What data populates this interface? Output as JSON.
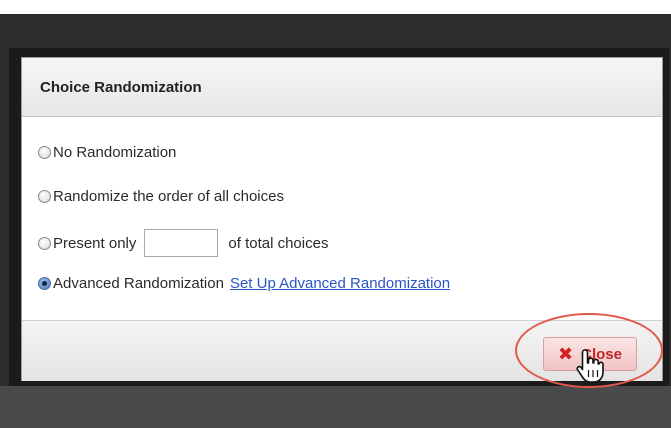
{
  "dialog": {
    "title": "Choice Randomization",
    "options": [
      {
        "label": "No Randomization",
        "selected": false
      },
      {
        "label": "Randomize the order of all choices",
        "selected": false
      },
      {
        "label_before": "Present only",
        "label_after": "of total choices",
        "input_value": "",
        "selected": false
      },
      {
        "label": "Advanced Randomization",
        "link_label": "Set Up Advanced Randomization",
        "selected": true
      }
    ],
    "close_label": "Close"
  },
  "icons": {
    "close_button_icon": "close-x-icon",
    "pointer": "hand-pointer-icon"
  },
  "colors": {
    "link": "#2a55c4",
    "close_text": "#c12727",
    "highlight_ring": "#e05a4c",
    "overlay": "#2c2c2e"
  }
}
